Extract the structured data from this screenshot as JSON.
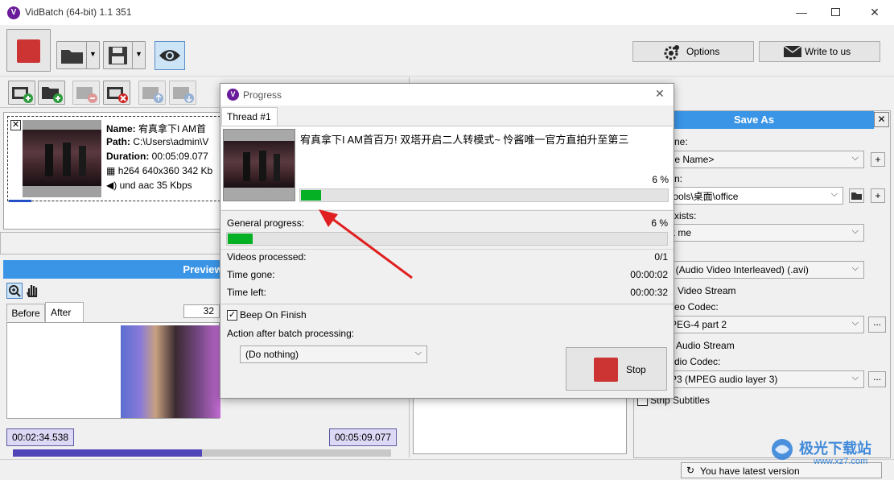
{
  "window": {
    "title": "VidBatch (64-bit) 1.1 351",
    "minimize": "—",
    "maximize": "☐",
    "close": "✕"
  },
  "toolbar": {
    "options_label": "Options",
    "write_label": "Write to us"
  },
  "file_item": {
    "name_label": "Name:",
    "name_value": "宥真拿下I AM首",
    "path_label": "Path:",
    "path_value": "C:\\Users\\admin\\V",
    "duration_label": "Duration:",
    "duration_value": "00:05:09.077",
    "video_info": "h264 640x360 342 Kb",
    "audio_info": "und aac 35 Kbps"
  },
  "preview": {
    "header": "Preview",
    "tab_before": "Before",
    "tab_after": "After",
    "zoom_value": "32",
    "time_start": "00:02:34.538",
    "time_end": "00:05:09.077",
    "scrub_fraction": 0.5
  },
  "save_as": {
    "header": "Save As",
    "name_label": "ne:",
    "name_value": "ile Name>",
    "path_label": "n:",
    "path_value": "tools\\桌面\\office",
    "exists_label": "xists:",
    "exists_value": "k me",
    "format_value": "I (Audio Video Interleaved) (.avi)",
    "video_stream_label": "Video Stream",
    "video_codec_label": "eo Codec:",
    "video_codec_value": "PEG-4 part 2",
    "audio_stream_label": "Audio Stream",
    "audio_codec_label": "dio Codec:",
    "audio_codec_value": "P3 (MPEG audio layer 3)",
    "strip_subtitles_label": "Strip Subtitles",
    "ellipsis": "..."
  },
  "status": {
    "latest_version": "You have latest version"
  },
  "dialog": {
    "title": "Progress",
    "close": "✕",
    "tab_thread": "Thread #1",
    "video_title": "宥真拿下I AM首百万! 双塔开启二人转模式~ 怜酱唯一官方直拍升至第三",
    "thread_percent": "6 %",
    "thread_progress": 0.06,
    "general_label": "General progress:",
    "general_percent": "6 %",
    "general_progress": 0.06,
    "videos_processed_label": "Videos processed:",
    "videos_processed_value": "0/1",
    "time_gone_label": "Time gone:",
    "time_gone_value": "00:00:02",
    "time_left_label": "Time left:",
    "time_left_value": "00:00:32",
    "beep_label": "Beep On Finish",
    "beep_checked": true,
    "action_label": "Action after batch processing:",
    "action_value": "(Do nothing)",
    "stop_label": "Stop"
  },
  "watermark": {
    "brand": "极光下载站",
    "url": "www.xz7.com"
  },
  "colors": {
    "accent": "#3b95e6",
    "progress": "#06b025",
    "stop_red": "#cc3333",
    "arrow": "#e02020"
  }
}
